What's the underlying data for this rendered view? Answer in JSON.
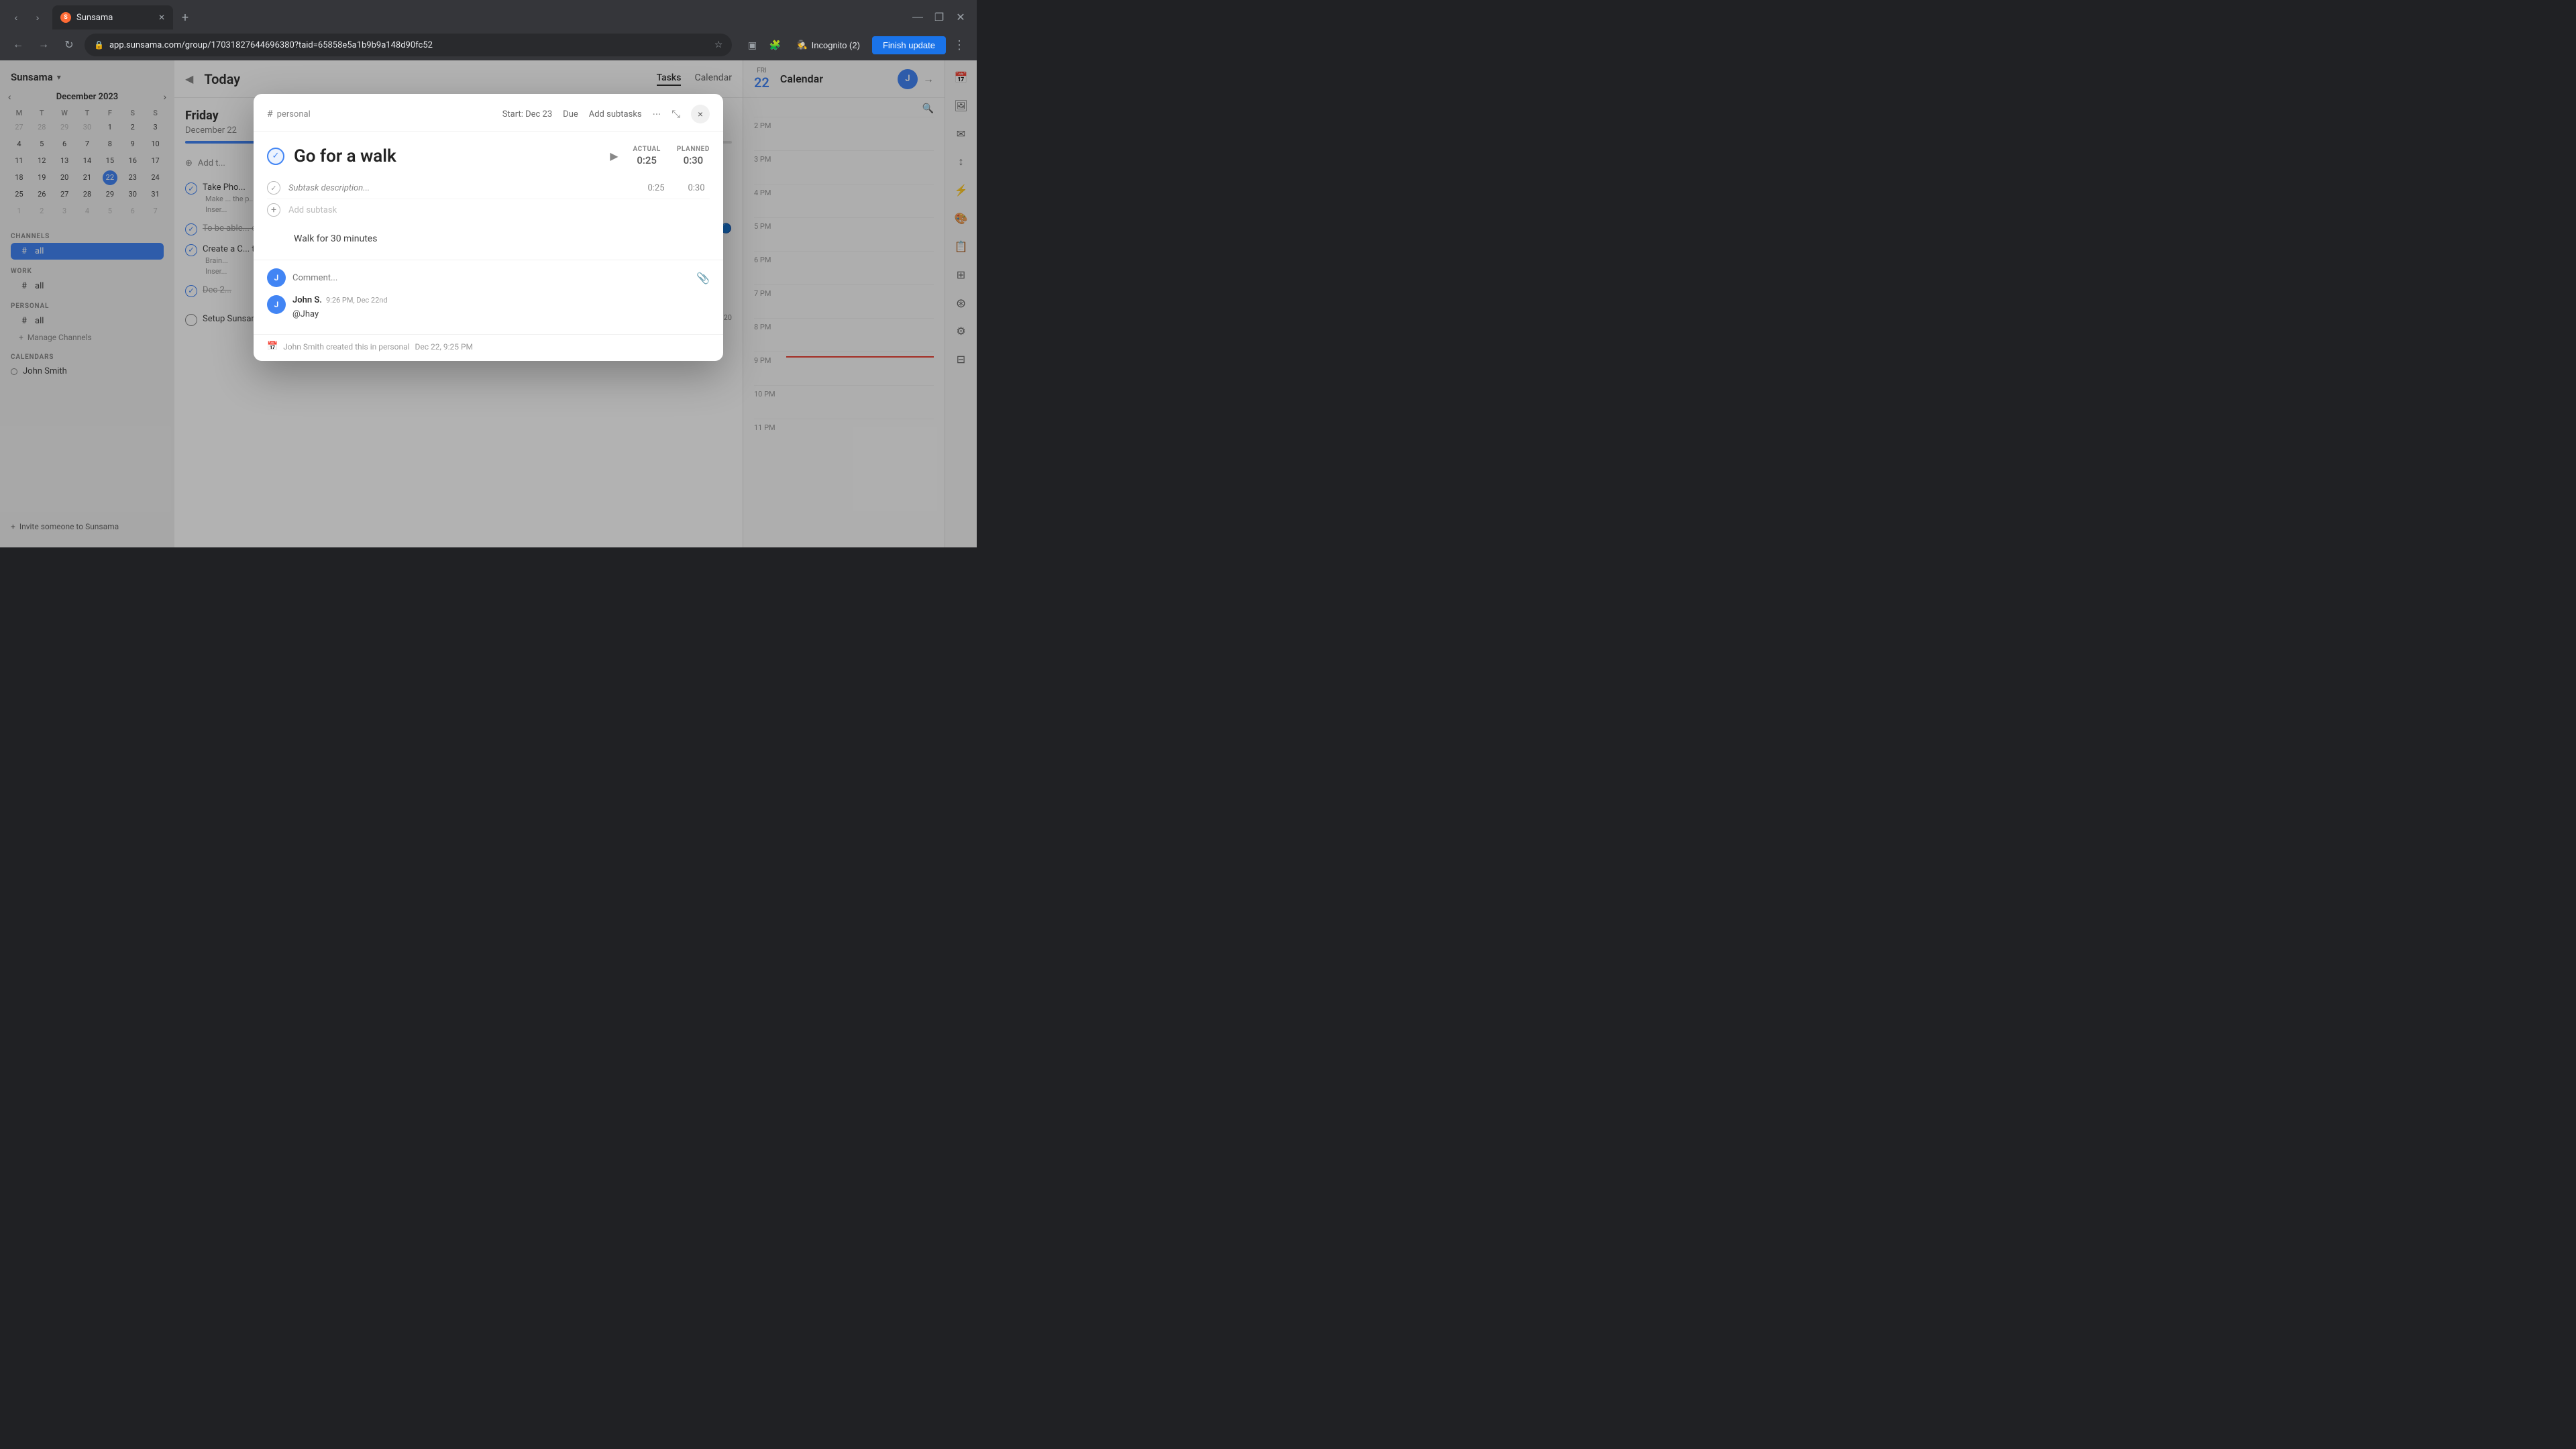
{
  "browser": {
    "tab_label": "Sunsama",
    "tab_favicon": "S",
    "url": "app.sunsama.com/group/17031827644696380?taid=65858e5a1b9b9a148d90fc52",
    "incognito_label": "Incognito (2)",
    "finish_update_label": "Finish update",
    "window_minimize": "—",
    "window_restore": "❐",
    "window_close": "✕"
  },
  "sidebar": {
    "app_name": "Sunsama",
    "calendar_month": "December 2023",
    "calendar_days_header": [
      "M",
      "T",
      "W",
      "T",
      "F",
      "S",
      "S"
    ],
    "calendar_weeks": [
      [
        "27",
        "28",
        "29",
        "30",
        "1",
        "2",
        "3"
      ],
      [
        "4",
        "5",
        "6",
        "7",
        "8",
        "9",
        "10"
      ],
      [
        "11",
        "12",
        "13",
        "14",
        "15",
        "16",
        "17"
      ],
      [
        "18",
        "19",
        "20",
        "21",
        "22",
        "23",
        "24"
      ],
      [
        "25",
        "26",
        "27",
        "28",
        "29",
        "30",
        "31"
      ],
      [
        "1",
        "2",
        "3",
        "4",
        "5",
        "6",
        "7"
      ]
    ],
    "today_day": "22",
    "channels_label": "CHANNELS",
    "channels": [
      {
        "label": "all",
        "icon": "#",
        "active": true
      }
    ],
    "work_label": "WORK",
    "work_channels": [
      {
        "label": "all",
        "icon": "#"
      }
    ],
    "personal_label": "PERSONAL",
    "personal_channels": [
      {
        "label": "all",
        "icon": "#"
      }
    ],
    "manage_label": "Manage Channels",
    "calendars_label": "CALENDARS",
    "calendar_items": [
      {
        "label": "John Smith"
      }
    ],
    "invite_label": "Invite someone to Sunsama"
  },
  "main": {
    "header_collapse_icon": "◀",
    "title": "Today",
    "tabs": [
      {
        "label": "Tasks",
        "active": true
      },
      {
        "label": "Calendar"
      }
    ],
    "day_header": "Friday",
    "day_date": "December 22",
    "progress_pct": 40,
    "add_task_label": "Add t...",
    "tasks": [
      {
        "text": "Take Pho...",
        "subtask": "Make ... the p...",
        "subtask2": "Inser..."
      },
      {
        "text": "To be able ... content"
      },
      {
        "text": "Create a C... the news l...",
        "subtask": "Brain...",
        "subtask2": "Inser..."
      },
      {
        "text": "Dec 2...",
        "time": ""
      }
    ],
    "setup_label": "Setup Sunsama",
    "setup_time": "0:20"
  },
  "right_panel": {
    "title": "Calendar",
    "avatar_label": "J",
    "time_slots": [
      {
        "time": "2 PM",
        "content": ""
      },
      {
        "time": "3 PM",
        "content": ""
      },
      {
        "time": "4 PM",
        "content": ""
      },
      {
        "time": "5 PM",
        "content": ""
      },
      {
        "time": "6 PM",
        "content": ""
      },
      {
        "time": "7 PM",
        "content": ""
      },
      {
        "time": "8 PM",
        "content": ""
      },
      {
        "time": "9 PM",
        "content": ""
      },
      {
        "time": "10 PM",
        "content": ""
      },
      {
        "time": "11 PM",
        "content": ""
      }
    ],
    "calendar_day": "FRI",
    "calendar_date": "22"
  },
  "modal": {
    "channel_icon": "#",
    "channel_label": "personal",
    "start_label": "Start: Dec 23",
    "due_label": "Due",
    "add_subtasks_label": "Add subtasks",
    "task_title": "Go for a walk",
    "actual_label": "ACTUAL",
    "planned_label": "PLANNED",
    "actual_value": "0:25",
    "planned_value": "0:30",
    "subtask_placeholder": "Subtask description...",
    "subtask_actual": "0:25",
    "subtask_planned": "0:30",
    "add_subtask_label": "Add subtask",
    "notes": "Walk for 30 minutes",
    "comment_placeholder": "Comment...",
    "comment_avatar": "J",
    "comment_author": "John S.",
    "comment_time": "9:26 PM, Dec 22nd",
    "comment_text": "@Jhay",
    "created_text": "John Smith created this in personal",
    "created_time": "Dec 22, 9:25 PM"
  },
  "icons": {
    "hash": "#",
    "plus": "+",
    "close": "×",
    "check": "✓",
    "play": "▶",
    "expand": "⤡",
    "more": "...",
    "attach": "📎",
    "calendar_created": "📅",
    "chevron_left": "‹",
    "chevron_right": "›",
    "arrow_left": "←",
    "arrow_right": "→",
    "refresh": "↻",
    "star": "☆",
    "sidebar_toggle": "☰",
    "zoom_in": "🔍"
  }
}
